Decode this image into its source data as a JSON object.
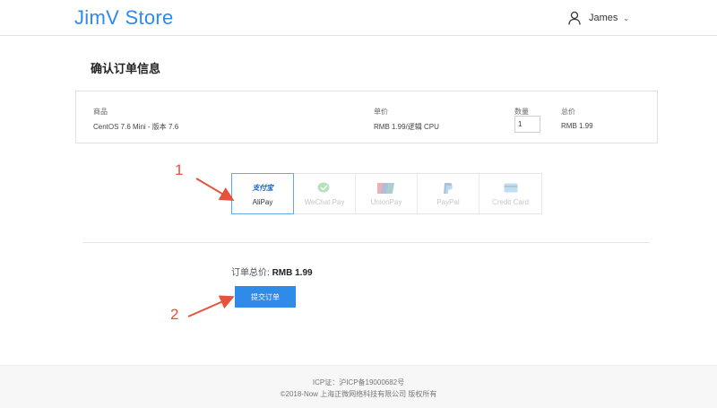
{
  "header": {
    "brand": "JimV Store",
    "user_name": "James",
    "caret": "⌄"
  },
  "page": {
    "title": "确认订单信息"
  },
  "order": {
    "headers": {
      "product": "商品",
      "unit_price": "单价",
      "quantity": "数量",
      "total": "总价"
    },
    "row": {
      "product": "CentOS 7.6 Mini - 版本 7.6",
      "unit_price": "RMB 1.99/逻辑 CPU",
      "quantity": "1",
      "total": "RMB 1.99"
    }
  },
  "payment": {
    "options": [
      {
        "label": "AliPay",
        "logo_text": "支付宝",
        "selected": true
      },
      {
        "label": "WeChat Pay",
        "selected": false
      },
      {
        "label": "UnionPay",
        "selected": false
      },
      {
        "label": "PayPal",
        "selected": false
      },
      {
        "label": "Credit Card",
        "selected": false
      }
    ]
  },
  "summary": {
    "total_label": "订单总价:",
    "total_value": "RMB 1.99",
    "submit_label": "提交订单"
  },
  "annotations": {
    "one": "1",
    "two": "2",
    "color": "#e8513a"
  },
  "footer": {
    "icp": "ICP证：沪ICP备19000682号",
    "copyright": "©2018-Now 上海正微网络科技有限公司 版权所有"
  },
  "colors": {
    "accent": "#2f8ae8"
  }
}
